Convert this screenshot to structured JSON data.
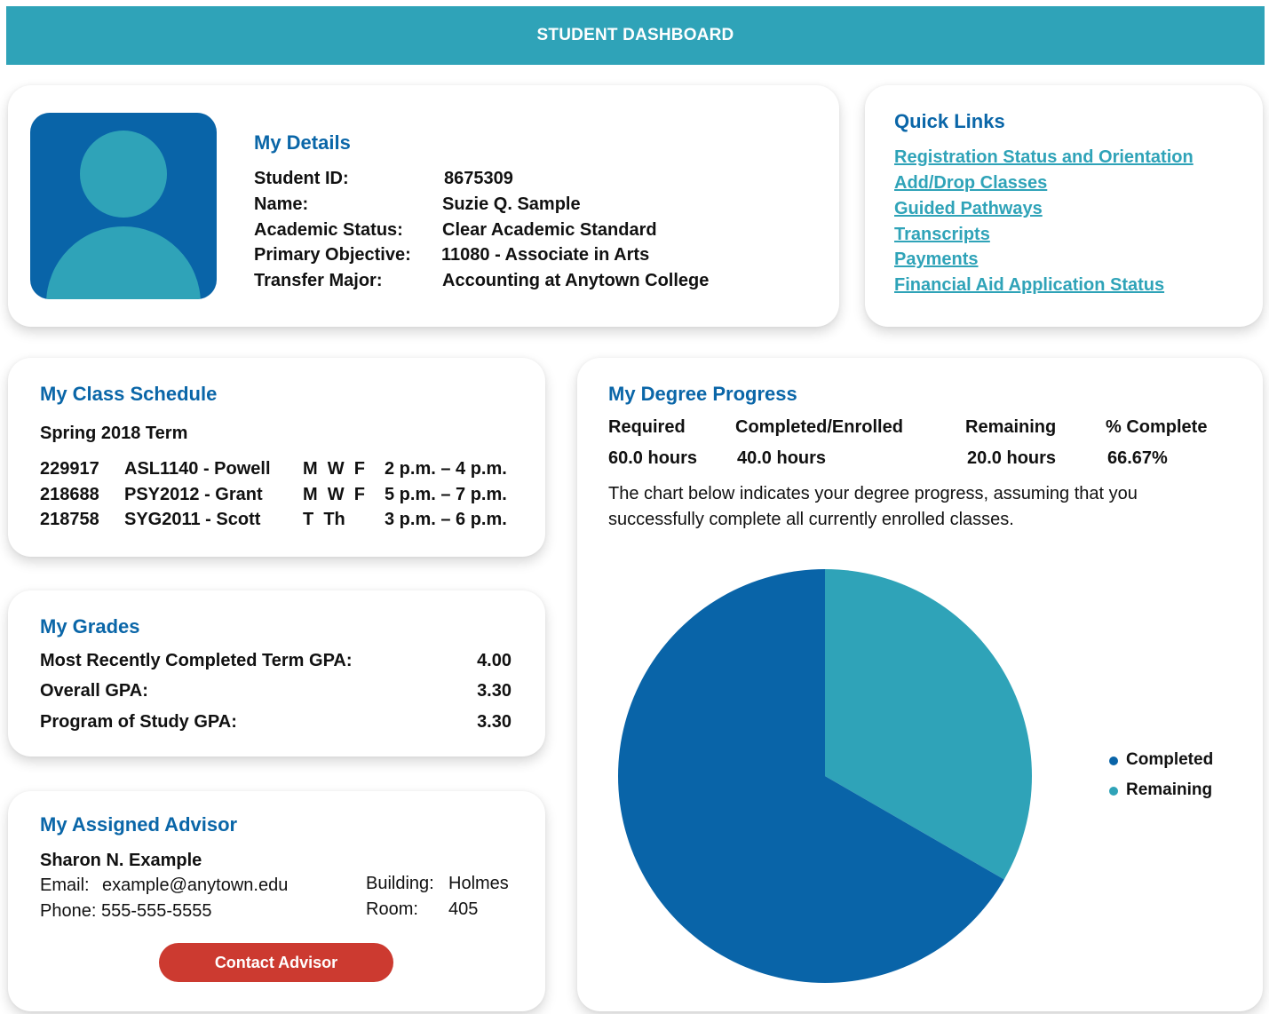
{
  "header": {
    "title": "STUDENT DASHBOARD"
  },
  "details": {
    "heading": "My Details",
    "rows": [
      {
        "label": "Student ID:",
        "value": "8675309"
      },
      {
        "label": "Name:",
        "value": "Suzie Q. Sample"
      },
      {
        "label": "Academic Status:",
        "value": "Clear Academic Standard"
      },
      {
        "label": "Primary Objective:",
        "value": "11080 - Associate in Arts"
      },
      {
        "label": "Transfer Major:",
        "value": "Accounting at Anytown College"
      }
    ]
  },
  "quick_links": {
    "heading": "Quick Links",
    "links": [
      "Registration Status and Orientation",
      "Add/Drop Classes",
      "Guided Pathways",
      "Transcripts",
      "Payments",
      "Financial Aid Application Status"
    ]
  },
  "schedule": {
    "heading": "My Class Schedule",
    "term": "Spring 2018 Term",
    "classes": [
      {
        "id": "229917",
        "course": "ASL1140 - Powell",
        "days": "M  W  F",
        "time": "2 p.m. – 4 p.m."
      },
      {
        "id": "218688",
        "course": "PSY2012 - Grant",
        "days": "M  W  F",
        "time": "5 p.m. – 7 p.m."
      },
      {
        "id": "218758",
        "course": "SYG2011 - Scott",
        "days": "T  Th",
        "time": "3 p.m. – 6 p.m."
      }
    ]
  },
  "grades": {
    "heading": "My Grades",
    "rows": [
      {
        "label": "Most Recently Completed Term GPA:",
        "value": "4.00"
      },
      {
        "label": "Overall GPA:",
        "value": "3.30"
      },
      {
        "label": "Program of Study GPA:",
        "value": "3.30"
      }
    ]
  },
  "advisor": {
    "heading": "My Assigned Advisor",
    "name": "Sharon N. Example",
    "email_label": "Email:",
    "email": "example@anytown.edu",
    "phone_label": "Phone:",
    "phone": "555-555-5555",
    "building_label": "Building:",
    "building": "Holmes",
    "room_label": "Room:",
    "room": "405",
    "button": "Contact Advisor"
  },
  "progress": {
    "heading": "My Degree Progress",
    "col_required": "Required",
    "col_completed": "Completed/Enrolled",
    "col_remaining": "Remaining",
    "col_percent": "% Complete",
    "val_required": "60.0 hours",
    "val_completed": "40.0 hours",
    "val_remaining": "20.0 hours",
    "val_percent": "66.67%",
    "description_line1": "The chart below indicates your degree progress, assuming that you",
    "description_line2": "successfully complete all currently enrolled classes."
  },
  "chart_data": {
    "type": "pie",
    "categories": [
      "Completed",
      "Remaining"
    ],
    "values": [
      40,
      20
    ],
    "colors": [
      "#0964a8",
      "#2fa3b8"
    ],
    "legend_position": "right"
  },
  "colors": {
    "header": "#2fa3b8",
    "heading_blue": "#0a66a8",
    "link_teal": "#2fa3b8",
    "button_red": "#cc3a30"
  }
}
